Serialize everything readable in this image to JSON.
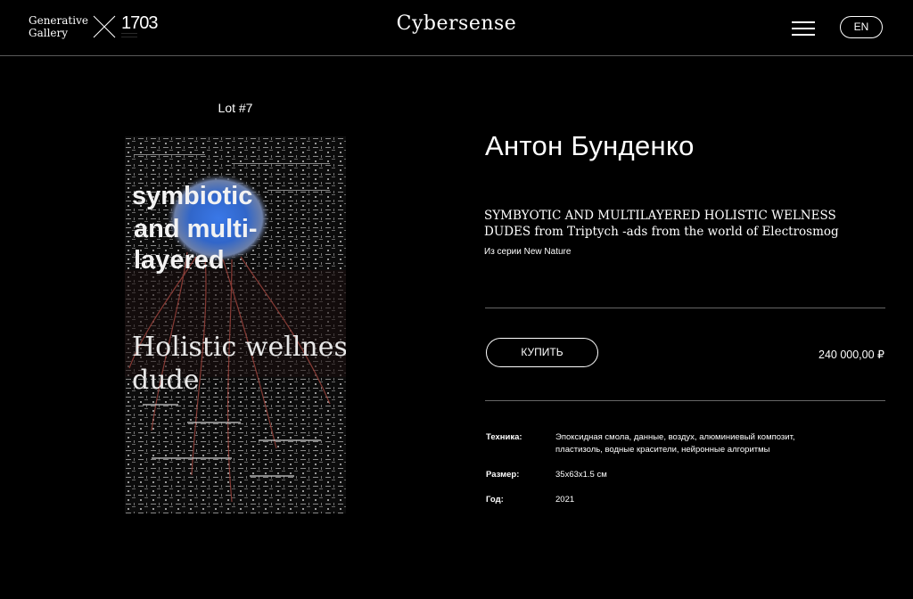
{
  "header": {
    "logo_line1": "Generative",
    "logo_line2": "Gallery",
    "logo_number": "1703",
    "site_title": "Cybersense",
    "menu_icon": "hamburger-menu-icon",
    "language": "EN"
  },
  "lot": {
    "label": "Lot #7"
  },
  "artwork": {
    "overlay_line1": "symbiotic",
    "overlay_line2": "and multi-",
    "overlay_line3": "layered",
    "overlay_line4": "Holistic wellness",
    "overlay_line5": "dude"
  },
  "details": {
    "artist": "Антон Бунденко",
    "title": "SYMBYOTIC AND MULTILAYERED HOLISTIC WELNESS DUDES from Triptych -ads from the world of Electrosmog",
    "series": "Из серии New Nature",
    "buy_label": "КУПИТЬ",
    "price": "240 000,00 ₽"
  },
  "specs": {
    "technique_label": "Техника:",
    "technique_value": "Эпоксидная смола, данные, воздух, алюминиевый композит, пластизоль, водные красители, нейронные алгоритмы",
    "size_label": "Размер:",
    "size_value": "35x63x1.5 см",
    "year_label": "Год:",
    "year_value": "2021"
  },
  "colors": {
    "background": "#000000",
    "text": "#ffffff",
    "divider": "#666666"
  }
}
